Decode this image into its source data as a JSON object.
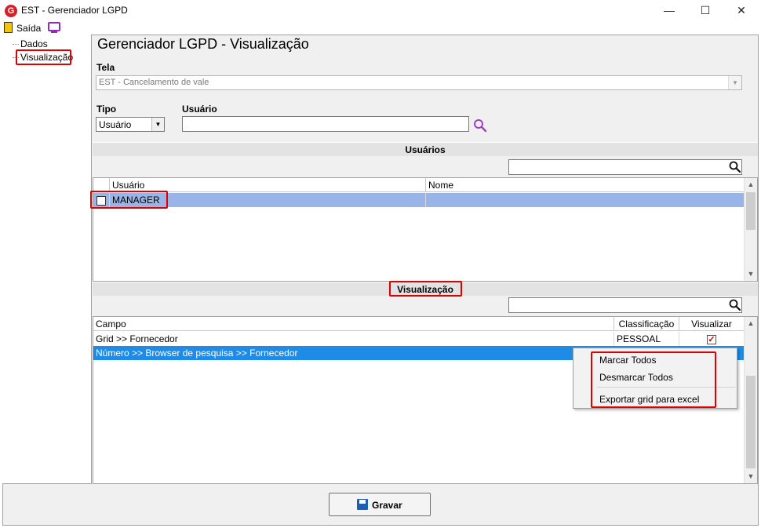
{
  "window": {
    "title": "EST - Gerenciador LGPD",
    "logo": "G",
    "minimize": "—",
    "maximize": "☐",
    "close": "✕"
  },
  "menubar": {
    "exit_label": "Saída"
  },
  "tree": {
    "items": [
      "Dados",
      "Visualização"
    ]
  },
  "page_title": "Gerenciador LGPD - Visualização",
  "tela": {
    "label": "Tela",
    "value": "EST - Cancelamento de vale"
  },
  "tipo": {
    "label": "Tipo",
    "value": "Usuário"
  },
  "usuario": {
    "label": "Usuário",
    "value": ""
  },
  "usuarios_section": {
    "title": "Usuários",
    "columns": [
      "Usuário",
      "Nome"
    ],
    "rows": [
      {
        "usuario": "MANAGER",
        "nome": ""
      }
    ]
  },
  "visualizacao_section": {
    "title": "Visualização",
    "columns": [
      "Campo",
      "Classificação",
      "Visualizar"
    ],
    "rows": [
      {
        "campo": "Grid >> Fornecedor",
        "classificacao": "PESSOAL",
        "visualizar": "✓"
      },
      {
        "campo": "Número >> Browser de pesquisa >> Fornecedor",
        "classificacao": "",
        "visualizar": ""
      }
    ]
  },
  "context_menu": {
    "items": [
      "Marcar Todos",
      "Desmarcar Todos",
      "Exportar grid para excel"
    ]
  },
  "save_button": {
    "label": "Gravar"
  },
  "colors": {
    "selection_light": "#99b4e6",
    "selection_dark": "#1e8ce6",
    "highlight_box": "#e00000",
    "accent_purple": "#8e2db5",
    "logo_red": "#d81f26"
  }
}
